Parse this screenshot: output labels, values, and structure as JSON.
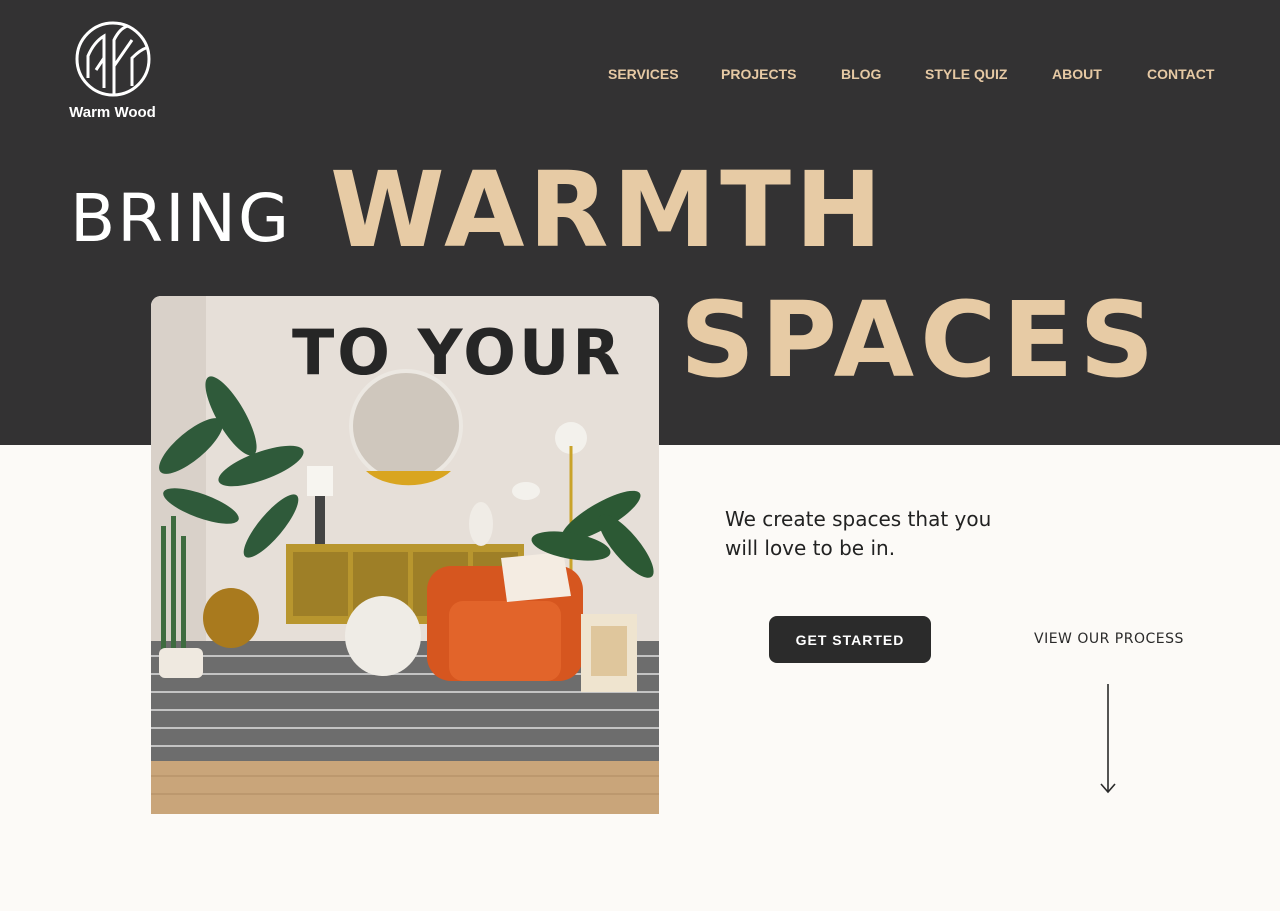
{
  "brand": {
    "name": "Warm Wood",
    "logo_icon": "circle-leaf-logo-icon"
  },
  "nav": {
    "items": [
      "SERVICES",
      "PROJECTS",
      "BLOG",
      "STYLE QUIZ",
      "ABOUT",
      "CONTACT"
    ]
  },
  "hero": {
    "line1_a": "BRING",
    "line1_b": "WARMTH",
    "line2_a": "TO YOUR",
    "line2_b": "SPACES",
    "tagline": "We create spaces that you will love to be in.",
    "cta_primary": "GET STARTED",
    "cta_secondary": "VIEW OUR PROCESS",
    "scroll_icon": "arrow-down-icon"
  },
  "colors": {
    "dark_band": "#333233",
    "accent_beige": "#e7cba5",
    "page_bg": "#fcfaf7",
    "button_bg": "#2b2b2b"
  }
}
